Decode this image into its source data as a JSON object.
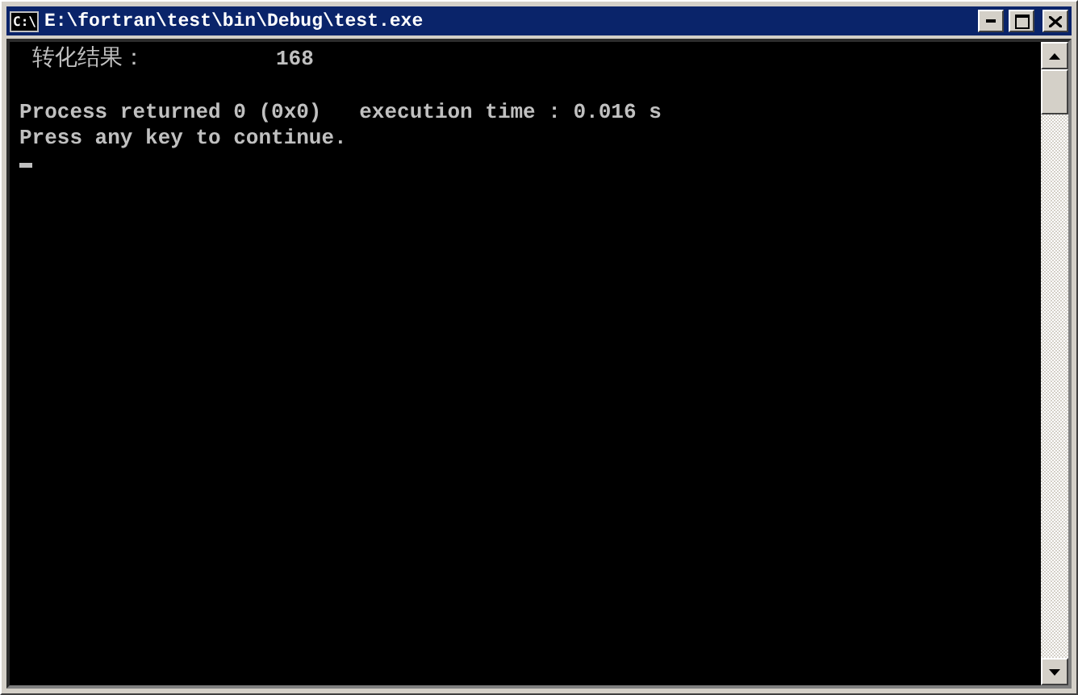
{
  "window": {
    "icon": "C:\\",
    "title": "E:\\fortran\\test\\bin\\Debug\\test.exe"
  },
  "console": {
    "lines": [
      {
        "kind": "pair",
        "label": "转化结果：",
        "value": "168"
      },
      {
        "kind": "blank"
      },
      {
        "kind": "text",
        "text": "Process returned 0 (0x0)   execution time : 0.016 s"
      },
      {
        "kind": "text",
        "text": "Press any key to continue."
      },
      {
        "kind": "cursor"
      }
    ]
  }
}
